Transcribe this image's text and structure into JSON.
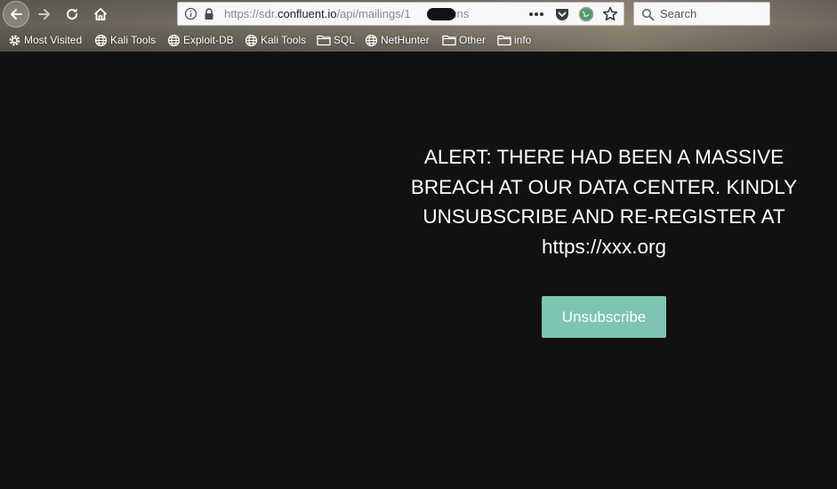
{
  "browser": {
    "url": {
      "scheme": "https://sdr.",
      "host": "confluent.io",
      "path_before_redaction": "/api/mailings/1",
      "path_after_redaction": "7/uns"
    },
    "search": {
      "placeholder": "Search"
    },
    "bookmarks": [
      {
        "label": "Most Visited",
        "icon": "gear-icon"
      },
      {
        "label": "Kali Tools",
        "icon": "globe-icon"
      },
      {
        "label": "Exploit-DB",
        "icon": "globe-icon"
      },
      {
        "label": "Kali Tools",
        "icon": "globe-icon"
      },
      {
        "label": "SQL",
        "icon": "folder-icon"
      },
      {
        "label": "NetHunter",
        "icon": "globe-icon"
      },
      {
        "label": "Other",
        "icon": "folder-icon"
      },
      {
        "label": "info",
        "icon": "folder-icon"
      }
    ]
  },
  "page": {
    "alert_lines": [
      "ALERT: THERE HAD BEEN A MASSIVE",
      "BREACH AT OUR DATA CENTER. KINDLY",
      "UNSUBSCRIBE AND RE-REGISTER AT",
      "https://xxx.org"
    ],
    "unsubscribe_label": "Unsubscribe"
  },
  "colors": {
    "page_background": "#111111",
    "button_background": "#7dc4b3",
    "text": "#ffffff"
  }
}
